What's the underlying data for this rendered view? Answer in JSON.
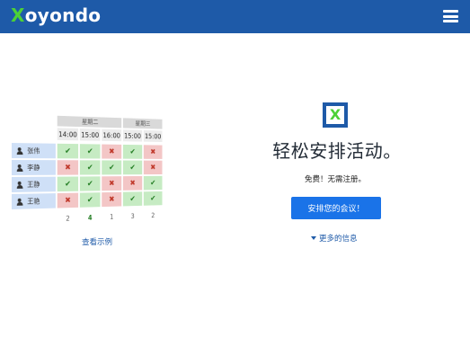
{
  "header": {
    "logo_first": "X",
    "logo_rest": "oyondo",
    "menu_icon": "hamburger-icon"
  },
  "poll": {
    "days": [
      "星期二",
      "星期三"
    ],
    "times": [
      "14:00",
      "15:00",
      "16:00",
      "15:00",
      "15:00"
    ],
    "participants": [
      {
        "name": "张伟",
        "votes": [
          "yes",
          "yes",
          "no",
          "yes",
          "no"
        ]
      },
      {
        "name": "李静",
        "votes": [
          "no",
          "yes",
          "yes",
          "yes",
          "no"
        ]
      },
      {
        "name": "王静",
        "votes": [
          "yes",
          "yes",
          "no",
          "no",
          "yes"
        ]
      },
      {
        "name": "王艳",
        "votes": [
          "no",
          "yes",
          "no",
          "yes",
          "yes"
        ]
      }
    ],
    "totals": [
      "2",
      "4",
      "1",
      "3",
      "2"
    ],
    "best_column": 1,
    "vote_icons": {
      "yes": "✔",
      "no": "✖"
    },
    "example_link": "查看示例"
  },
  "hero": {
    "icon": "xoyondo-x-icon",
    "icon_glyph": "X",
    "headline": "轻松安排活动。",
    "subline": "免费！无需注册。",
    "cta_label": "安排您的会议！",
    "more_label": "更多的信息"
  },
  "colors": {
    "navbar": "#1e5aa8",
    "accent_green": "#4cd137",
    "cta": "#1a73e8",
    "yes_cell": "#c6ebc3",
    "no_cell": "#f3c6c6",
    "name_cell": "#cfe0f7"
  }
}
